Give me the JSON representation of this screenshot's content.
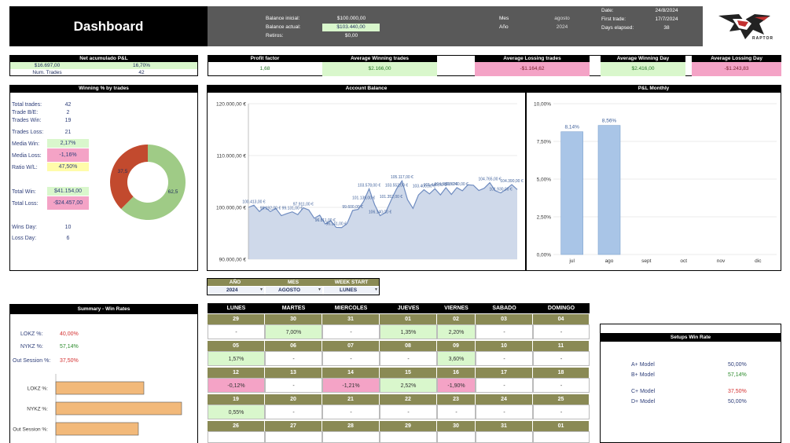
{
  "header": {
    "title": "Dashboard",
    "balance_inicial_label": "Balance inicial:",
    "balance_inicial": "$100.000,00",
    "balance_actual_label": "Balance actual:",
    "balance_actual": "$103.440,00",
    "retiros_label": "Retiros:",
    "retiros": "$0,00",
    "mes_label": "Mes",
    "mes": "agosto",
    "anio_label": "Año",
    "anio": "2024",
    "date_label": "Date:",
    "date": "24/8/2024",
    "first_trade_label": "First trade:",
    "first_trade": "17/7/2024",
    "days_elapsed_label": "Days elapsed:",
    "days_elapsed": "38",
    "logo_text": "RAPTOR"
  },
  "kpis": {
    "net_pl_label": "Net acumulado P&L",
    "net_pl_value": "$16.697,00",
    "net_pl_pct": "16,70%",
    "num_trades_label": "Num. Trades",
    "num_trades": "42",
    "profit_factor_label": "Profit factor",
    "profit_factor": "1,68",
    "avg_win_trades_label": "Average Winning trades",
    "avg_win_trades": "$2.166,00",
    "avg_loss_trades_label": "Average Lossing trades",
    "avg_loss_trades": "-$1.164,62",
    "avg_win_day_label": "Average Winning Day",
    "avg_win_day": "$2.416,00",
    "avg_loss_day_label": "Average Lossing Day",
    "avg_loss_day": "-$1.243,83"
  },
  "winning": {
    "title": "Winning % by trades",
    "total_trades_label": "Total trades:",
    "total_trades": "42",
    "trade_be_label": "Trade B/E:",
    "trade_be": "2",
    "trades_win_label": "Trades Win:",
    "trades_win": "19",
    "trades_loss_label": "Trades Loss:",
    "trades_loss": "21",
    "media_win_label": "Media Win:",
    "media_win": "2,17%",
    "media_loss_label": "Media Loss:",
    "media_loss": "-1,16%",
    "ratio_label": "Ratio W/L:",
    "ratio": "47,50%",
    "total_win_label": "Total Win:",
    "total_win": "$41.154,00",
    "total_loss_label": "Total Loss:",
    "total_loss": "-$24.457,00",
    "wins_day_label": "Wins Day:",
    "wins_day": "10",
    "loss_day_label": "Loss Day:",
    "loss_day": "6",
    "donut": {
      "win_pct": 62.5,
      "loss_pct": 37.5,
      "win_label": "62,5",
      "loss_label": "37,5",
      "win_color": "#9fcb86",
      "loss_color": "#c24a2e"
    }
  },
  "chart_data": [
    {
      "type": "area",
      "title": "Account Balance",
      "ylim": [
        90000,
        120000
      ],
      "yticks": [
        "90.000,00 €",
        "100.000,00 €",
        "110.000,00 €",
        "120.000,00 €"
      ],
      "ytick_values": [
        90000,
        100000,
        110000,
        120000
      ],
      "values": [
        100000,
        100413,
        99200,
        100050,
        99192,
        99800,
        98400,
        98800,
        99131,
        98600,
        99911,
        99500,
        97900,
        98500,
        96800,
        97400,
        96141,
        96100,
        96900,
        99400,
        99600,
        101139,
        103578,
        100550,
        98400,
        99000,
        101352,
        103552,
        105117,
        101500,
        99800,
        102400,
        103400,
        102600,
        103600,
        102400,
        103800,
        102500,
        103800,
        103200,
        104350,
        104270,
        103245,
        103700,
        104765,
        103200,
        102800,
        103500,
        104390,
        103440
      ],
      "data_labels": [
        {
          "i": 1,
          "t": "100.413,00 €"
        },
        {
          "i": 4,
          "t": "99.192,00 €"
        },
        {
          "i": 8,
          "t": "99.131,00 €"
        },
        {
          "i": 10,
          "t": "97.911,00 €"
        },
        {
          "i": 14,
          "t": "96.811,00 €"
        },
        {
          "i": 16,
          "t": "96.141,00 €"
        },
        {
          "i": 19,
          "t": "99.600,00 €"
        },
        {
          "i": 21,
          "t": "101.139,00 €"
        },
        {
          "i": 22,
          "t": "103.578,00 €"
        },
        {
          "i": 24,
          "t": "106.140,00 €"
        },
        {
          "i": 26,
          "t": "101.352,00 €"
        },
        {
          "i": 27,
          "t": "103.552,00 €"
        },
        {
          "i": 28,
          "t": "105.117,00 €"
        },
        {
          "i": 32,
          "t": "103.400,00 €"
        },
        {
          "i": 34,
          "t": "101.440,00 €"
        },
        {
          "i": 36,
          "t": "104.350,00 €"
        },
        {
          "i": 38,
          "t": "103.240,00 €"
        },
        {
          "i": 44,
          "t": "104.765,00 €"
        },
        {
          "i": 46,
          "t": "101.930,00 €"
        },
        {
          "i": 48,
          "t": "104.390,00 €"
        }
      ],
      "fill": "#cfd9ea",
      "line": "#6f8cc0"
    },
    {
      "type": "bar",
      "title": "P&L Monthly",
      "categories": [
        "jul",
        "ago",
        "sept",
        "oct",
        "nov",
        "dic"
      ],
      "values": [
        8.14,
        8.56,
        0,
        0,
        0,
        0
      ],
      "value_labels": [
        "8,14%",
        "8,56%",
        "",
        "",
        "",
        ""
      ],
      "ylim": [
        0,
        10
      ],
      "yticks": [
        "0,00%",
        "2,50%",
        "5,00%",
        "7,50%",
        "10,00%"
      ],
      "ytick_values": [
        0,
        2.5,
        5,
        7.5,
        10
      ],
      "bar_color": "#a9c5e7"
    },
    {
      "type": "bar",
      "title": "Summary - Win Rates",
      "categories": [
        "LOKZ %:",
        "NYKZ %:",
        "Out Session %:"
      ],
      "values": [
        40.0,
        57.14,
        37.5
      ],
      "xlim": [
        0,
        60
      ],
      "bar_color": "#f2b97a"
    }
  ],
  "account_title": "Account Balance",
  "monthly_title": "P&L Monthly",
  "filters": {
    "anio_label": "AÑO",
    "anio": "2024",
    "mes_label": "MES",
    "mes": "AGOSTO",
    "week_label": "WEEK START",
    "week": "LUNES"
  },
  "summary": {
    "title": "Summary - Win Rates",
    "lokz_label": "LOKZ %:",
    "lokz": "40,00%",
    "nykz_label": "NYKZ %:",
    "nykz": "57,14%",
    "out_label": "Out Session %:",
    "out": "37,50%"
  },
  "calendar": {
    "days": [
      "LUNES",
      "MARTES",
      "MIERCOLES",
      "JUEVES",
      "VIERNES",
      "SABADO",
      "DOMINGO"
    ],
    "weeks": [
      {
        "dates": [
          "29",
          "30",
          "31",
          "01",
          "02",
          "03",
          "04"
        ],
        "vals": [
          "-",
          "7,00%",
          "-",
          "1,35%",
          "2,20%",
          "-",
          "-"
        ],
        "kinds": [
          "",
          "g",
          "",
          "g",
          "g",
          "",
          ""
        ]
      },
      {
        "dates": [
          "05",
          "06",
          "07",
          "08",
          "09",
          "10",
          "11"
        ],
        "vals": [
          "1,57%",
          "-",
          "-",
          "-",
          "3,60%",
          "-",
          "-"
        ],
        "kinds": [
          "g",
          "",
          "",
          "",
          "g",
          "",
          ""
        ]
      },
      {
        "dates": [
          "12",
          "13",
          "14",
          "15",
          "16",
          "17",
          "18"
        ],
        "vals": [
          "-0,12%",
          "-",
          "-1,21%",
          "2,52%",
          "-1,90%",
          "-",
          "-"
        ],
        "kinds": [
          "p",
          "",
          "p",
          "g",
          "p",
          "",
          ""
        ]
      },
      {
        "dates": [
          "19",
          "20",
          "21",
          "22",
          "23",
          "24",
          "25"
        ],
        "vals": [
          "0,55%",
          "-",
          "-",
          "-",
          "-",
          "-",
          "-"
        ],
        "kinds": [
          "g",
          "",
          "",
          "",
          "",
          "",
          ""
        ]
      },
      {
        "dates": [
          "26",
          "27",
          "28",
          "29",
          "30",
          "31",
          "01"
        ],
        "vals": [
          "",
          "",
          "",
          "",
          "",
          "",
          ""
        ],
        "kinds": [
          "",
          "",
          "",
          "",
          "",
          "",
          ""
        ]
      }
    ]
  },
  "setups": {
    "title": "Setups Win Rate",
    "rows": [
      {
        "label": "A+ Model",
        "value": "50,00%"
      },
      {
        "label": "B+ Model",
        "value": "57,14%"
      },
      {
        "label": "C+ Model",
        "value": "37,50%"
      },
      {
        "label": "D+ Model",
        "value": "50,00%"
      }
    ]
  }
}
